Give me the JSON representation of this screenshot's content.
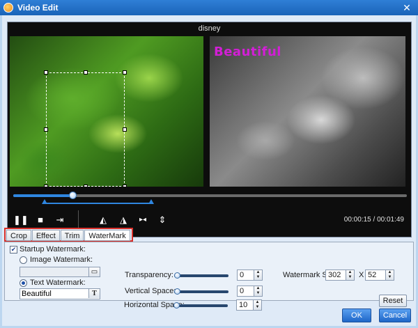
{
  "window": {
    "title": "Video Edit"
  },
  "video": {
    "filename": "disney",
    "watermark_preview": "Beautiful",
    "current_time": "00:00:15",
    "separator": "/",
    "total_time": "00:01:49",
    "playback_progress": 0.15
  },
  "controls": [
    {
      "name": "pause-icon",
      "glyph": "❚❚"
    },
    {
      "name": "stop-icon",
      "glyph": "■"
    },
    {
      "name": "snapshot-icon",
      "glyph": "⇥"
    },
    {
      "name": "rotate-left-icon",
      "glyph": "◭"
    },
    {
      "name": "rotate-right-icon",
      "glyph": "◮"
    },
    {
      "name": "flip-horizontal-icon",
      "glyph": "▸◂"
    },
    {
      "name": "flip-vertical-icon",
      "glyph": "⇕"
    }
  ],
  "tabs": [
    {
      "label": "Crop"
    },
    {
      "label": "Effect"
    },
    {
      "label": "Trim"
    },
    {
      "label": "WaterMark"
    }
  ],
  "active_tab": "WaterMark",
  "watermark": {
    "startup_label": "Startup Watermark:",
    "startup_checked": true,
    "image_label": "Image Watermark:",
    "image_path": "",
    "text_label": "Text Watermark:",
    "text_value": "Beautiful",
    "transparency_label": "Transparency:",
    "transparency_value": "0",
    "vertical_label": "Vertical Space:",
    "vertical_value": "0",
    "horizontal_label": "Horizontal Space:",
    "horizontal_value": "10",
    "size_label": "Watermark Size:",
    "size_width": "302",
    "size_x": "X",
    "size_height": "52",
    "reset_label": "Reset"
  },
  "footer": {
    "ok_label": "OK",
    "cancel_label": "Cancel"
  },
  "colors": {
    "accent": "#2f86e0",
    "watermark_text": "#d21fd6",
    "highlight": "#d9302a"
  }
}
